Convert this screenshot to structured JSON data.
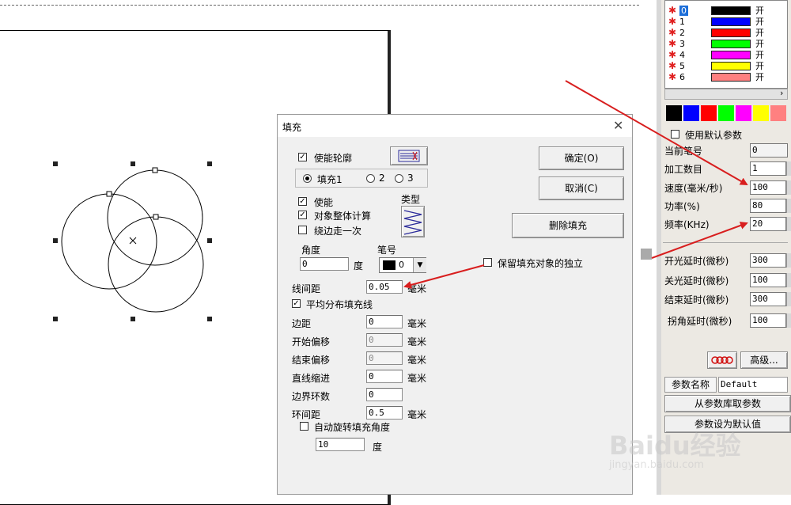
{
  "dialog": {
    "title": "填充",
    "enable_outline": "使能轮廓",
    "fill_tab1": "填充1",
    "fill_tab2": "2",
    "fill_tab3": "3",
    "enable": "使能",
    "whole_object_calc": "对象整体计算",
    "go_around_once": "绕边走一次",
    "type_label": "类型",
    "angle_label": "角度",
    "angle_value": "0",
    "degree_unit": "度",
    "pen_label": "笔号",
    "pen_value": "0",
    "line_spacing_label": "线间距",
    "line_spacing_value": "0.05",
    "mm_unit": "毫米",
    "average_distribute": "平均分布填充线",
    "margin_label": "边距",
    "margin_value": "0",
    "start_offset_label": "开始偏移",
    "start_offset_value": "0",
    "end_offset_label": "结束偏移",
    "end_offset_value": "0",
    "line_indent_label": "直线缩进",
    "line_indent_value": "0",
    "boundary_rings_label": "边界环数",
    "boundary_rings_value": "0",
    "ring_spacing_label": "环间距",
    "ring_spacing_value": "0.5",
    "auto_rotate": "自动旋转填充角度",
    "rotate_value": "10",
    "rotate_unit": "度",
    "ok_button": "确定(O)",
    "cancel_button": "取消(C)",
    "delete_fill_button": "删除填充",
    "keep_independent": "保留填充对象的独立"
  },
  "pens": [
    {
      "num": "0",
      "color": "#000000",
      "state": "开"
    },
    {
      "num": "1",
      "color": "#0000ff",
      "state": "开"
    },
    {
      "num": "2",
      "color": "#ff0000",
      "state": "开"
    },
    {
      "num": "3",
      "color": "#00ff00",
      "state": "开"
    },
    {
      "num": "4",
      "color": "#ff00ff",
      "state": "开"
    },
    {
      "num": "5",
      "color": "#ffff00",
      "state": "开"
    },
    {
      "num": "6",
      "color": "#ff8080",
      "state": "开"
    }
  ],
  "palette": [
    "#000000",
    "#0000ff",
    "#ff0000",
    "#00ff00",
    "#ff00ff",
    "#ffff00",
    "#ff8080"
  ],
  "params": {
    "use_default": "使用默认参数",
    "current_pen_label": "当前笔号",
    "current_pen_value": "0",
    "count_label": "加工数目",
    "count_value": "1",
    "speed_label": "速度(毫米/秒)",
    "speed_value": "100",
    "power_label": "功率(%)",
    "power_value": "80",
    "freq_label": "频率(KHz)",
    "freq_value": "20",
    "on_delay_label": "开光延时(微秒)",
    "on_delay_value": "300",
    "off_delay_label": "关光延时(微秒)",
    "off_delay_value": "100",
    "end_delay_label": "结束延时(微秒)",
    "end_delay_value": "300",
    "corner_delay_label": "拐角延时(微秒)",
    "corner_delay_value": "100",
    "advanced_button": "高级...",
    "param_name_label": "参数名称",
    "param_name_value": "Default",
    "from_library_button": "从参数库取参数",
    "set_default_button": "参数设为默认值"
  },
  "watermark": {
    "brand": "Baidu经验",
    "url": "jingyan.baidu.com"
  }
}
